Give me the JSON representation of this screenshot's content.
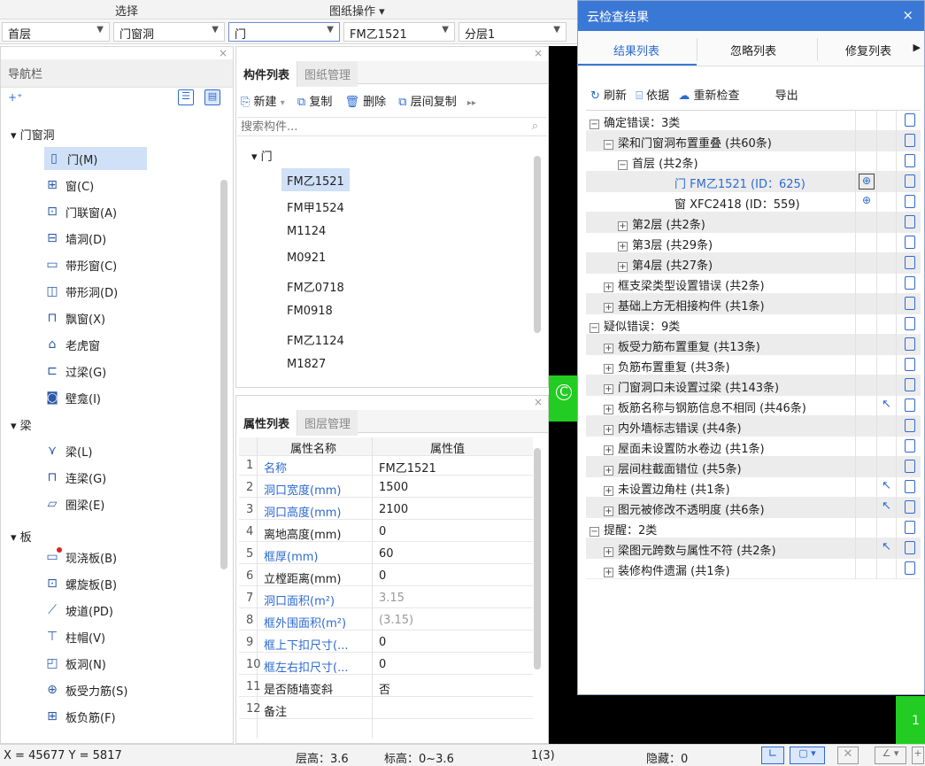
{
  "topbar": {
    "left": "选择",
    "right": "图纸操作 ▾"
  },
  "selectors": {
    "floor": "首层",
    "category": "门窗洞",
    "type": "门",
    "component": "FM乙1521",
    "layer": "分层1"
  },
  "nav": {
    "title": "导航栏",
    "groups": [
      {
        "label": "门窗洞"
      },
      {
        "label": "梁"
      },
      {
        "label": "板"
      }
    ],
    "items": [
      {
        "label": "门(M)",
        "icon": "door-icon"
      },
      {
        "label": "窗(C)",
        "icon": "window-icon"
      },
      {
        "label": "门联窗(A)",
        "icon": "door-window-icon"
      },
      {
        "label": "墙洞(D)",
        "icon": "wall-hole-icon"
      },
      {
        "label": "带形窗(C)",
        "icon": "strip-window-icon"
      },
      {
        "label": "带形洞(D)",
        "icon": "strip-hole-icon"
      },
      {
        "label": "飘窗(X)",
        "icon": "bay-window-icon"
      },
      {
        "label": "老虎窗",
        "icon": "dormer-icon"
      },
      {
        "label": "过梁(G)",
        "icon": "lintel-icon"
      },
      {
        "label": "壁龛(I)",
        "icon": "niche-icon"
      },
      {
        "label": "梁(L)",
        "icon": "beam-icon"
      },
      {
        "label": "连梁(G)",
        "icon": "coupling-beam-icon"
      },
      {
        "label": "圈梁(E)",
        "icon": "ring-beam-icon"
      },
      {
        "label": "现浇板(B)",
        "icon": "slab-icon"
      },
      {
        "label": "螺旋板(B)",
        "icon": "spiral-slab-icon"
      },
      {
        "label": "坡道(PD)",
        "icon": "ramp-icon"
      },
      {
        "label": "柱帽(V)",
        "icon": "column-cap-icon"
      },
      {
        "label": "板洞(N)",
        "icon": "slab-hole-icon"
      },
      {
        "label": "板受力筋(S)",
        "icon": "slab-rebar-icon"
      },
      {
        "label": "板负筋(F)",
        "icon": "neg-rebar-icon"
      }
    ]
  },
  "components": {
    "tab_active": "构件列表",
    "tab_inactive": "图纸管理",
    "toolbar": {
      "new": "新建",
      "copy": "复制",
      "delete": "删除",
      "floor_copy": "层间复制"
    },
    "search_placeholder": "搜索构件...",
    "group": "门",
    "items": [
      "FM乙1521",
      "FM甲1524",
      "M1124",
      "M0921",
      "FM乙0718",
      "FM0918",
      "FM乙1124",
      "M1827"
    ]
  },
  "properties": {
    "tab_active": "属性列表",
    "tab_inactive": "图层管理",
    "header_name": "属性名称",
    "header_value": "属性值",
    "rows": [
      {
        "n": "1",
        "name": "名称",
        "value": "FM乙1521",
        "blue": true
      },
      {
        "n": "2",
        "name": "洞口宽度(mm)",
        "value": "1500",
        "blue": true
      },
      {
        "n": "3",
        "name": "洞口高度(mm)",
        "value": "2100",
        "blue": true
      },
      {
        "n": "4",
        "name": "离地高度(mm)",
        "value": "0",
        "blue": false
      },
      {
        "n": "5",
        "name": "框厚(mm)",
        "value": "60",
        "blue": true
      },
      {
        "n": "6",
        "name": "立樘距离(mm)",
        "value": "0",
        "blue": false
      },
      {
        "n": "7",
        "name": "洞口面积(m²)",
        "value": "3.15",
        "blue": true
      },
      {
        "n": "8",
        "name": "框外围面积(m²)",
        "value": "(3.15)",
        "blue": true
      },
      {
        "n": "9",
        "name": "框上下扣尺寸(...",
        "value": "0",
        "blue": true
      },
      {
        "n": "10",
        "name": "框左右扣尺寸(...",
        "value": "0",
        "blue": true
      },
      {
        "n": "11",
        "name": "是否随墙变斜",
        "value": "否",
        "blue": false
      },
      {
        "n": "12",
        "name": "备注",
        "value": "",
        "blue": false
      }
    ]
  },
  "cloud": {
    "title": "云检查结果",
    "tabs": [
      "结果列表",
      "忽略列表",
      "修复列表"
    ],
    "toolbar": {
      "refresh": "刷新",
      "basis": "依据",
      "recheck": "重新检查",
      "export": "导出"
    },
    "rows": [
      {
        "indent": 0,
        "pm": "−",
        "text": "确定错误：3类",
        "shade": false
      },
      {
        "indent": 1,
        "pm": "−",
        "text": "梁和门窗洞布置重叠 (共60条)",
        "shade": true
      },
      {
        "indent": 2,
        "pm": "−",
        "text": "首层 (共2条)",
        "shade": false
      },
      {
        "indent": 3,
        "pm": "",
        "text": "门 FM乙1521 (ID：625)",
        "shade": true,
        "blue": true,
        "locate": true
      },
      {
        "indent": 3,
        "pm": "",
        "text": "窗 XFC2418 (ID：559)",
        "shade": false,
        "locate": true
      },
      {
        "indent": 2,
        "pm": "+",
        "text": "第2层 (共2条)",
        "shade": true
      },
      {
        "indent": 2,
        "pm": "+",
        "text": "第3层 (共29条)",
        "shade": false
      },
      {
        "indent": 2,
        "pm": "+",
        "text": "第4层 (共27条)",
        "shade": true
      },
      {
        "indent": 1,
        "pm": "+",
        "text": "框支梁类型设置错误 (共2条)",
        "shade": false
      },
      {
        "indent": 1,
        "pm": "+",
        "text": "基础上方无相接构件 (共1条)",
        "shade": true
      },
      {
        "indent": 0,
        "pm": "−",
        "text": "疑似错误：9类",
        "shade": false
      },
      {
        "indent": 1,
        "pm": "+",
        "text": "板受力筋布置重复 (共13条)",
        "shade": true
      },
      {
        "indent": 1,
        "pm": "+",
        "text": "负筋布置重复 (共3条)",
        "shade": false
      },
      {
        "indent": 1,
        "pm": "+",
        "text": "门窗洞口未设置过梁 (共143条)",
        "shade": true
      },
      {
        "indent": 1,
        "pm": "+",
        "text": "板筋名称与钢筋信息不相同 (共46条)",
        "shade": false,
        "fix": true
      },
      {
        "indent": 1,
        "pm": "+",
        "text": "内外墙标志错误 (共4条)",
        "shade": true
      },
      {
        "indent": 1,
        "pm": "+",
        "text": "屋面未设置防水卷边 (共1条)",
        "shade": false
      },
      {
        "indent": 1,
        "pm": "+",
        "text": "层间柱截面错位 (共5条)",
        "shade": true
      },
      {
        "indent": 1,
        "pm": "+",
        "text": "未设置边角柱 (共1条)",
        "shade": false,
        "fix": true
      },
      {
        "indent": 1,
        "pm": "+",
        "text": "图元被修改不透明度 (共6条)",
        "shade": true,
        "fix": true
      },
      {
        "indent": 0,
        "pm": "−",
        "text": "提醒：2类",
        "shade": false
      },
      {
        "indent": 1,
        "pm": "+",
        "text": "梁图元跨数与属性不符 (共2条)",
        "shade": true,
        "fix": true
      },
      {
        "indent": 1,
        "pm": "+",
        "text": "装修构件遗漏 (共1条)",
        "shade": false
      }
    ]
  },
  "status": {
    "coords": "X = 45677 Y = 5817",
    "floor_height": "层高：3.6",
    "elevation": "标高：0~3.6",
    "count": "1(3)",
    "hidden": "隐藏：0"
  },
  "canvas": {
    "marker": "C",
    "marker2": "1"
  },
  "colors": {
    "accent": "#3a78d6",
    "link": "#2d6ad1",
    "green": "#22cc22"
  }
}
